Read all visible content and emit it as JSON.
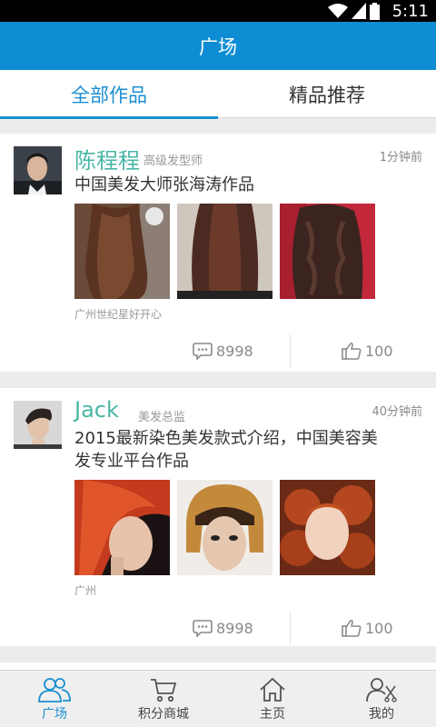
{
  "status_bar": {
    "time": "5:11"
  },
  "app_bar": {
    "title": "广场"
  },
  "tabs": [
    {
      "label": "全部作品",
      "active": true
    },
    {
      "label": "精品推荐",
      "active": false
    }
  ],
  "posts": [
    {
      "author": "陈程程",
      "role": "高级发型师",
      "time_ago": "1分钟前",
      "description": "中国美发大师张海涛作品",
      "location": "广州世纪星好开心",
      "comments": "8998",
      "likes": "100"
    },
    {
      "author": "Jack",
      "role": "美发总监",
      "time_ago": "40分钟前",
      "description": "2015最新染色美发款式介绍，中国美容美发专业平台作品",
      "location": "广州",
      "comments": "8998",
      "likes": "100"
    }
  ],
  "bottom_nav": [
    {
      "label": "广场",
      "icon": "people-icon",
      "active": true
    },
    {
      "label": "积分商城",
      "icon": "cart-icon",
      "active": false
    },
    {
      "label": "主页",
      "icon": "home-icon",
      "active": false
    },
    {
      "label": "我的",
      "icon": "profile-scissors-icon",
      "active": false
    }
  ],
  "colors": {
    "primary": "#0f8dd4",
    "accent": "#1a8fd0",
    "author_name": "#49b7a6"
  }
}
